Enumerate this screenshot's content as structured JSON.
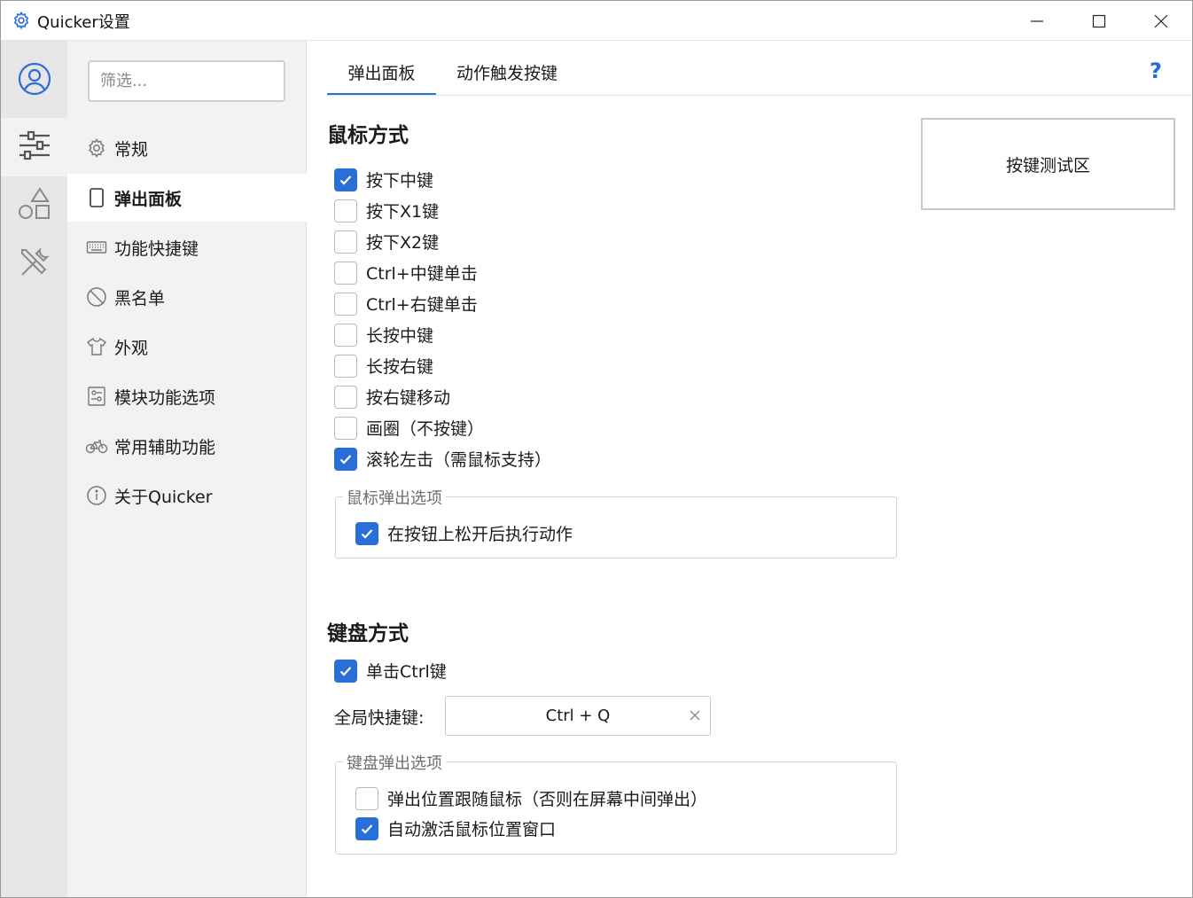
{
  "window": {
    "title": "Quicker设置",
    "icon": "gear-icon"
  },
  "rail": {
    "items": [
      {
        "name": "account",
        "icon": "user-circle-icon"
      },
      {
        "name": "settings",
        "icon": "sliders-icon",
        "active": true
      },
      {
        "name": "actions",
        "icon": "shapes-icon"
      },
      {
        "name": "tools",
        "icon": "tools-icon"
      }
    ]
  },
  "nav": {
    "filter_placeholder": "筛选...",
    "items": [
      {
        "label": "常规",
        "icon": "gear-icon"
      },
      {
        "label": "弹出面板",
        "icon": "phone-icon",
        "active": true
      },
      {
        "label": "功能快捷键",
        "icon": "keyboard-icon"
      },
      {
        "label": "黑名单",
        "icon": "block-icon"
      },
      {
        "label": "外观",
        "icon": "tshirt-icon"
      },
      {
        "label": "模块功能选项",
        "icon": "module-icon"
      },
      {
        "label": "常用辅助功能",
        "icon": "bicycle-icon"
      },
      {
        "label": "关于Quicker",
        "icon": "info-icon"
      }
    ]
  },
  "tabs": [
    {
      "label": "弹出面板",
      "active": true
    },
    {
      "label": "动作触发按键",
      "active": false
    }
  ],
  "help_label": "?",
  "mouse": {
    "title": "鼠标方式",
    "options": [
      {
        "label": "按下中键",
        "checked": true
      },
      {
        "label": "按下X1键",
        "checked": false
      },
      {
        "label": "按下X2键",
        "checked": false
      },
      {
        "label": "Ctrl+中键单击",
        "checked": false
      },
      {
        "label": "Ctrl+右键单击",
        "checked": false
      },
      {
        "label": "长按中键",
        "checked": false
      },
      {
        "label": "长按右键",
        "checked": false
      },
      {
        "label": "按右键移动",
        "checked": false
      },
      {
        "label": "画圈（不按键）",
        "checked": false
      },
      {
        "label": "滚轮左击（需鼠标支持）",
        "checked": true
      }
    ],
    "popup_group": {
      "legend": "鼠标弹出选项",
      "options": [
        {
          "label": "在按钮上松开后执行动作",
          "checked": true
        }
      ]
    }
  },
  "keyboard": {
    "title": "键盘方式",
    "single_ctrl": {
      "label": "单击Ctrl键",
      "checked": true
    },
    "hotkey_label": "全局快捷键:",
    "hotkey_value": "Ctrl + Q",
    "popup_group": {
      "legend": "键盘弹出选项",
      "options": [
        {
          "label": "弹出位置跟随鼠标（否则在屏幕中间弹出）",
          "checked": false
        },
        {
          "label": "自动激活鼠标位置窗口",
          "checked": true
        }
      ]
    }
  },
  "test_area_label": "按键测试区",
  "colors": {
    "accent": "#2a6ed9",
    "help": "#1f6fe0",
    "rail_bg": "#e6e6e6",
    "nav_bg": "#f2f2f2"
  }
}
